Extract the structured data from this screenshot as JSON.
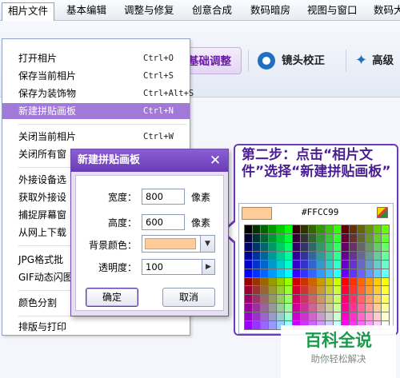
{
  "menubar": {
    "items": [
      "相片文件",
      "基本编辑",
      "调整与修复",
      "创意合成",
      "数码暗房",
      "视图与窗口",
      "数码大"
    ]
  },
  "toolbar": {
    "basic_adjust": "基础调整",
    "lens_correct": "镜头校正",
    "advanced_partial": "高级"
  },
  "file_menu": {
    "items": [
      {
        "label": "打开相片",
        "shortcut": "Ctrl+O"
      },
      {
        "label": "保存当前相片",
        "shortcut": "Ctrl+S"
      },
      {
        "label": "保存为装饰物",
        "shortcut": "Ctrl+Alt+S"
      },
      {
        "label": "新建拼贴画板",
        "shortcut": "Ctrl+N"
      },
      {
        "label": "关闭当前相片",
        "shortcut": "Ctrl+W"
      },
      {
        "label": "关闭所有窗",
        "shortcut": ""
      },
      {
        "label": "外接设备选",
        "shortcut": ""
      },
      {
        "label": "获取外接设",
        "shortcut": ""
      },
      {
        "label": "捕捉屏幕窗",
        "shortcut": ""
      },
      {
        "label": "从网上下载",
        "shortcut": ""
      },
      {
        "label": "JPG格式批",
        "shortcut": ""
      },
      {
        "label": "GIF动态闪图",
        "shortcut": ""
      },
      {
        "label": "颜色分割",
        "shortcut": ""
      },
      {
        "label": "排版与打印",
        "shortcut": ""
      }
    ]
  },
  "dialog": {
    "title": "新建拼贴画板",
    "close_glyph": "✕",
    "width_label": "宽度：",
    "width_value": "800",
    "width_unit": "像素",
    "height_label": "高度：",
    "height_value": "600",
    "height_unit": "像素",
    "bg_color_label": "背景颜色：",
    "bg_color": "#FFCC99",
    "opacity_label": "透明度：",
    "opacity_value": "100",
    "ok_label": "确定",
    "cancel_label": "取消"
  },
  "callout": {
    "text": "第二步：点击“相片文件”选择“新建拼贴画板”"
  },
  "palette": {
    "hex": "#FFCC99"
  },
  "watermark": {
    "title": "百科全说",
    "subtitle": "助你轻松解决"
  },
  "colors": {
    "accent": "#6a3bb9",
    "highlight": "#a179d9",
    "selected_color": "#FFCC99"
  }
}
